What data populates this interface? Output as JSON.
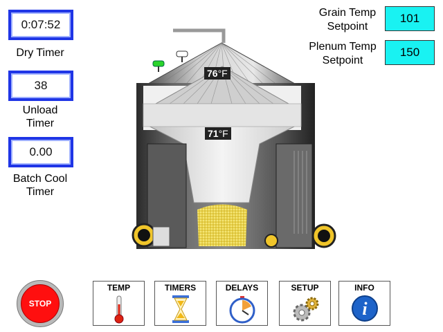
{
  "timers": {
    "dry": {
      "value": "0:07:52",
      "label": "Dry Timer"
    },
    "unload": {
      "value": "38",
      "label_line1": "Unload",
      "label_line2": "Timer"
    },
    "batch_cool": {
      "value": "0.00",
      "label_line1": "Batch Cool",
      "label_line2": "Timer"
    }
  },
  "setpoints": {
    "grain": {
      "label_line1": "Grain Temp",
      "label_line2": "Setpoint",
      "value": "101"
    },
    "plenum": {
      "label_line1": "Plenum Temp",
      "label_line2": "Setpoint",
      "value": "150"
    }
  },
  "bin": {
    "top_temp": "76",
    "mid_temp": "71",
    "unit": "°F"
  },
  "nav": {
    "temp": "TEMP",
    "timers": "TIMERS",
    "delays": "DELAYS",
    "setup": "SETUP",
    "info": "INFO"
  },
  "stop_label": "STOP",
  "colors": {
    "timer_border": "#1f35e6",
    "setpoint_bg": "#19f2f2",
    "stop_red": "#ff0f0f",
    "grain": "#e8d24a"
  }
}
